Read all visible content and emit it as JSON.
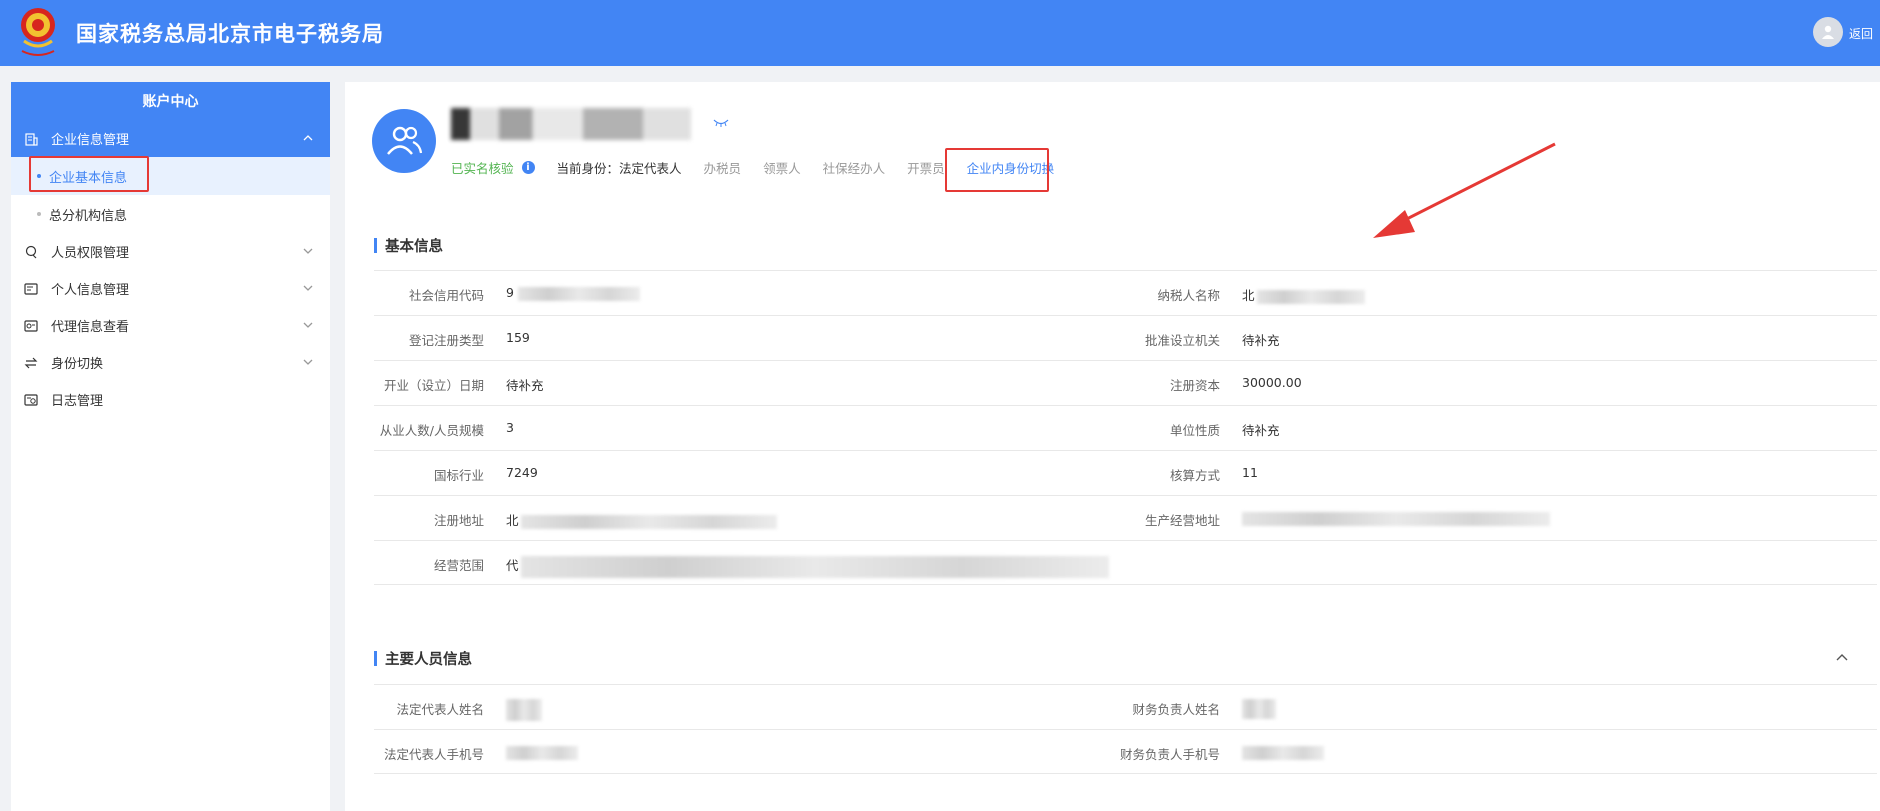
{
  "header": {
    "title": "国家税务总局北京市电子税务局",
    "back_label": "返回",
    "emblem_icon": "tax-emblem-icon",
    "brand_color": "#4285f4"
  },
  "sidebar": {
    "heading": "账户中心",
    "groups": [
      {
        "label": "企业信息管理",
        "icon": "building-icon",
        "expanded": true,
        "children": [
          {
            "label": "企业基本信息",
            "selected": true
          },
          {
            "label": "总分机构信息",
            "selected": false
          }
        ]
      },
      {
        "label": "人员权限管理",
        "icon": "user-permission-icon"
      },
      {
        "label": "个人信息管理",
        "icon": "id-card-icon"
      },
      {
        "label": "代理信息查看",
        "icon": "agent-icon"
      },
      {
        "label": "身份切换",
        "icon": "switch-icon"
      },
      {
        "label": "日志管理",
        "icon": "log-icon"
      }
    ]
  },
  "profile": {
    "verified_label": "已实名核验",
    "current_identity_label": "当前身份：",
    "current_identity_value": "法定代表人",
    "roles": [
      "办税员",
      "领票人",
      "社保经办人",
      "开票员"
    ],
    "switch_label": "企业内身份切换"
  },
  "basic_info": {
    "title": "基本信息",
    "rows": [
      {
        "left_label": "社会信用代码",
        "left_value": "9",
        "right_label": "纳税人名称",
        "right_value": "北"
      },
      {
        "left_label": "登记注册类型",
        "left_value": "159",
        "right_label": "批准设立机关",
        "right_value": "待补充"
      },
      {
        "left_label": "开业（设立）日期",
        "left_value": "待补充",
        "right_label": "注册资本",
        "right_value": "30000.00"
      },
      {
        "left_label": "从业人数/人员规模",
        "left_value": "3",
        "right_label": "单位性质",
        "right_value": "待补充"
      },
      {
        "left_label": "国标行业",
        "left_value": "7249",
        "right_label": "核算方式",
        "right_value": "11"
      },
      {
        "left_label": "注册地址",
        "left_value": "北",
        "right_label": "生产经营地址",
        "right_value": ""
      },
      {
        "left_label": "经营范围",
        "left_value": "代",
        "right_label": "",
        "right_value": ""
      }
    ]
  },
  "personnel_info": {
    "title": "主要人员信息",
    "rows": [
      {
        "left_label": "法定代表人姓名",
        "left_value": "",
        "right_label": "财务负责人姓名",
        "right_value": ""
      },
      {
        "left_label": "法定代表人手机号",
        "left_value": "",
        "right_label": "财务负责人手机号",
        "right_value": ""
      }
    ]
  }
}
